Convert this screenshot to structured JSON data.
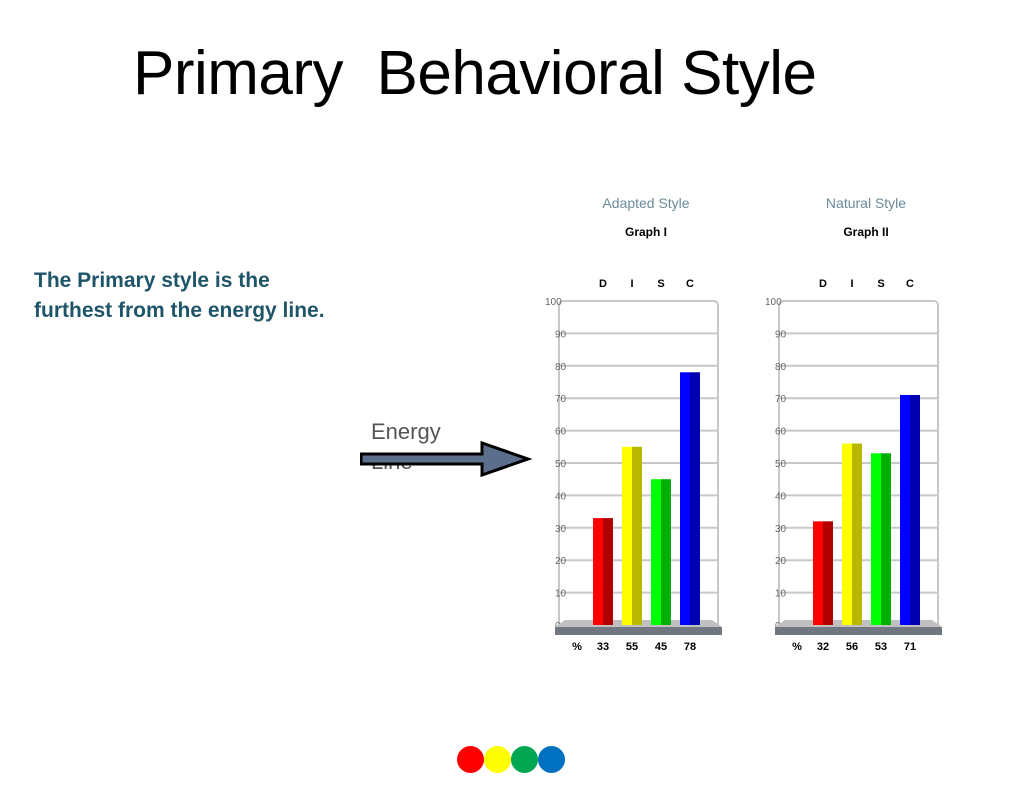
{
  "page": {
    "title": "Primary  Behavioral Style",
    "description_lines": [
      "The Primary style is the",
      "furthest from the energy line."
    ],
    "energy_label_lines": [
      "Energy",
      "Line"
    ],
    "dots": [
      {
        "name": "red",
        "color": "#ff0000"
      },
      {
        "name": "yellow",
        "color": "#ffff00"
      },
      {
        "name": "green",
        "color": "#00a650"
      },
      {
        "name": "blue",
        "color": "#0070c0"
      }
    ]
  },
  "chart_data": [
    {
      "type": "bar",
      "title": "Adapted Style",
      "subtitle": "Graph I",
      "categories": [
        "D",
        "I",
        "S",
        "C"
      ],
      "values": [
        33,
        55,
        45,
        78
      ],
      "value_prefix": "%",
      "colors": [
        "#ff0000",
        "#ffff00",
        "#00ff00",
        "#0000ff"
      ],
      "shade_colors": [
        "#b00000",
        "#b8b800",
        "#00b000",
        "#0000b0"
      ],
      "ylim": [
        0,
        100
      ],
      "yticks": [
        0,
        10,
        20,
        30,
        40,
        50,
        60,
        70,
        80,
        90,
        100
      ],
      "grid": true,
      "xlabel": "",
      "ylabel": ""
    },
    {
      "type": "bar",
      "title": "Natural Style",
      "subtitle": "Graph II",
      "categories": [
        "D",
        "I",
        "S",
        "C"
      ],
      "values": [
        32,
        56,
        53,
        71
      ],
      "value_prefix": "%",
      "colors": [
        "#ff0000",
        "#ffff00",
        "#00ff00",
        "#0000ff"
      ],
      "shade_colors": [
        "#b00000",
        "#b8b800",
        "#00b000",
        "#0000b0"
      ],
      "ylim": [
        0,
        100
      ],
      "yticks": [
        0,
        10,
        20,
        30,
        40,
        50,
        60,
        70,
        80,
        90,
        100
      ],
      "grid": true,
      "xlabel": "",
      "ylabel": ""
    }
  ]
}
